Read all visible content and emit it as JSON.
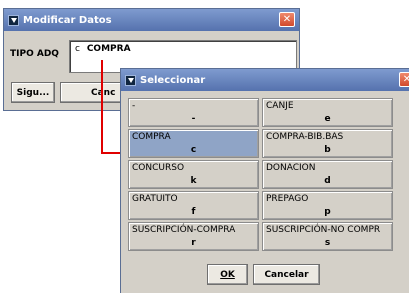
{
  "modificar": {
    "title": "Modificar Datos",
    "close_symbol": "✕",
    "field_label": "TIPO ADQ",
    "field_code": "c",
    "field_value": "COMPRA",
    "btn_siguiente": "Sigu...",
    "btn_cancelar_partial": "Canc"
  },
  "seleccionar": {
    "title": "Seleccionar",
    "close_symbol": "✕",
    "options": [
      {
        "name": "-",
        "code": "-"
      },
      {
        "name": "CANJE",
        "code": "e"
      },
      {
        "name": "COMPRA",
        "code": "c",
        "selected": true
      },
      {
        "name": "COMPRA-BIB.BAS",
        "code": "b"
      },
      {
        "name": "CONCURSO",
        "code": "k"
      },
      {
        "name": "DONACION",
        "code": "d"
      },
      {
        "name": "GRATUITO",
        "code": "f"
      },
      {
        "name": "PREPAGO",
        "code": "p"
      },
      {
        "name": "SUSCRIPCIÓN-COMPRA",
        "code": "r"
      },
      {
        "name": "SUSCRIPCIÓN-NO COMPR",
        "code": "s"
      }
    ],
    "ok_label": "OK",
    "cancel_label": "Cancelar"
  },
  "colors": {
    "connector": "#e00000",
    "selected_cell": "#8fa4c6",
    "titlebar": "#5572ae"
  }
}
